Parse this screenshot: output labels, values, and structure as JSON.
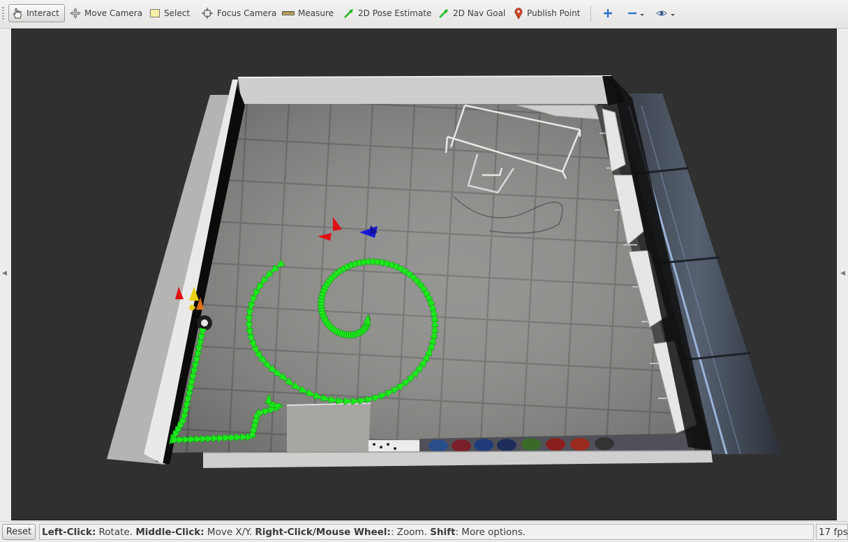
{
  "toolbar": {
    "tools": [
      {
        "label": "Interact",
        "icon": "hand-pointer-icon",
        "active": true
      },
      {
        "label": "Move Camera",
        "icon": "move-camera-icon"
      },
      {
        "label": "Select",
        "icon": "select-box-icon"
      },
      {
        "label": "Focus Camera",
        "icon": "crosshair-icon"
      },
      {
        "label": "Measure",
        "icon": "ruler-icon"
      },
      {
        "label": "2D Pose Estimate",
        "icon": "green-arrow-icon"
      },
      {
        "label": "2D Nav Goal",
        "icon": "green-arrow-icon"
      },
      {
        "label": "Publish Point",
        "icon": "map-pin-icon"
      }
    ],
    "extra": [
      "add-tool-icon",
      "remove-tool-icon",
      "view-eye-icon"
    ]
  },
  "statusbar": {
    "reset_label": "Reset",
    "hint": {
      "k1": "Left-Click:",
      "v1": " Rotate. ",
      "k2": "Middle-Click:",
      "v2": " Move X/Y. ",
      "k3": "Right-Click/Mouse Wheel:",
      "v3": ": Zoom. ",
      "k4": "Shift",
      "v4": ": More options."
    },
    "fps": "17 fps"
  },
  "colors": {
    "viewport_bg": "#303030",
    "path_arrow": "#1ee81e",
    "pose_red": "#e01010",
    "pose_blue": "#1a1ad8",
    "marker_yellow": "#e8d010",
    "marker_orange": "#e07010"
  }
}
